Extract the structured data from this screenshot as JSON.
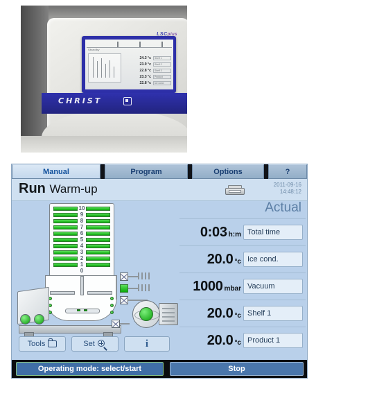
{
  "photo": {
    "brand": "CHRIST",
    "model": "LSC",
    "model_suffix": "plus",
    "screen_title": "Standby",
    "screen_rows": [
      {
        "value": "24.3 °c",
        "label": "Shelf 1"
      },
      {
        "value": "23.9 °c",
        "label": "Shelf 2"
      },
      {
        "value": "22.8 °c",
        "label": "Shelf 3"
      },
      {
        "value": "23.3 °c",
        "label": "Product"
      },
      {
        "value": "22.8 °c",
        "label": "Ice cond."
      }
    ]
  },
  "tabs": [
    {
      "label": "Manual",
      "active": true
    },
    {
      "label": "Program",
      "active": false
    },
    {
      "label": "Options",
      "active": false
    },
    {
      "label": "?",
      "active": false
    }
  ],
  "header": {
    "run_label": "Run",
    "mode_label": "Warm-up",
    "printer_icon": "printer-icon",
    "date": "2011-09-16",
    "time": "14:48:12"
  },
  "schematic": {
    "shelf_numbers": [
      "10",
      "9",
      "8",
      "7",
      "6",
      "5",
      "4",
      "3",
      "2",
      "1",
      "0"
    ],
    "shelf_state": "active",
    "pump_state": "running",
    "valves": [
      {
        "name": "valve-top",
        "open": false
      },
      {
        "name": "valve-middle",
        "open": true
      },
      {
        "name": "valve-bottom",
        "open": false
      }
    ]
  },
  "tool_buttons": [
    {
      "label": "Tools",
      "icon": "folder-icon"
    },
    {
      "label": "Set",
      "icon": "magnifier-icon"
    },
    {
      "label": "",
      "icon": "info-icon"
    }
  ],
  "readouts": {
    "column_header": "Actual",
    "rows": [
      {
        "value": "0:03",
        "unit": "h:m",
        "label": "Total time"
      },
      {
        "value": "20.0",
        "unit": "°c",
        "label": "Ice cond."
      },
      {
        "value": "1000",
        "unit": "mbar",
        "label": "Vacuum"
      },
      {
        "value": "20.0",
        "unit": "°c",
        "label": "Shelf 1"
      },
      {
        "value": "20.0",
        "unit": "°c",
        "label": "Product 1"
      }
    ]
  },
  "footer": {
    "status_label": "Operating mode: select/start",
    "stop_label": "Stop"
  },
  "colors": {
    "panel_bg": "#b9d0ea",
    "tab_active": "#dbe8f5",
    "tab_idle": "#aec3d8",
    "accent_green": "#0aa90a",
    "status_blue": "#3f6ea6",
    "brand_blue": "#2d2fa8"
  }
}
